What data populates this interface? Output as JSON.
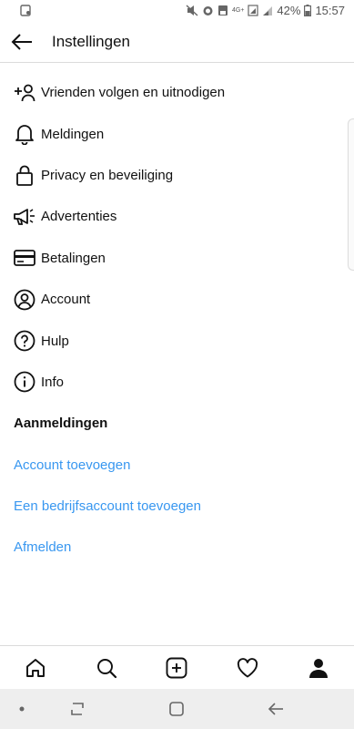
{
  "status_bar": {
    "network_label": "4G+",
    "battery_percent": "42%",
    "time": "15:57"
  },
  "header": {
    "title": "Instellingen"
  },
  "menu": {
    "items": [
      {
        "label": "Vrienden volgen en uitnodigen",
        "icon": "add-person-icon"
      },
      {
        "label": "Meldingen",
        "icon": "bell-icon"
      },
      {
        "label": "Privacy en beveiliging",
        "icon": "lock-icon"
      },
      {
        "label": "Advertenties",
        "icon": "megaphone-icon"
      },
      {
        "label": "Betalingen",
        "icon": "credit-card-icon"
      },
      {
        "label": "Account",
        "icon": "account-icon"
      },
      {
        "label": "Hulp",
        "icon": "help-icon"
      },
      {
        "label": "Info",
        "icon": "info-icon"
      }
    ]
  },
  "logins": {
    "header": "Aanmeldingen",
    "add_account": "Account toevoegen",
    "add_business_account": "Een bedrijfsaccount toevoegen",
    "logout": "Afmelden"
  },
  "colors": {
    "link": "#3897f0",
    "divider": "#dbdbdb",
    "nav_bar_bg": "#eeeeee"
  },
  "tab_bar": {
    "tabs": [
      "home-icon",
      "search-icon",
      "new-post-icon",
      "activity-heart-icon",
      "profile-icon"
    ],
    "active_tab": "profile-icon"
  }
}
